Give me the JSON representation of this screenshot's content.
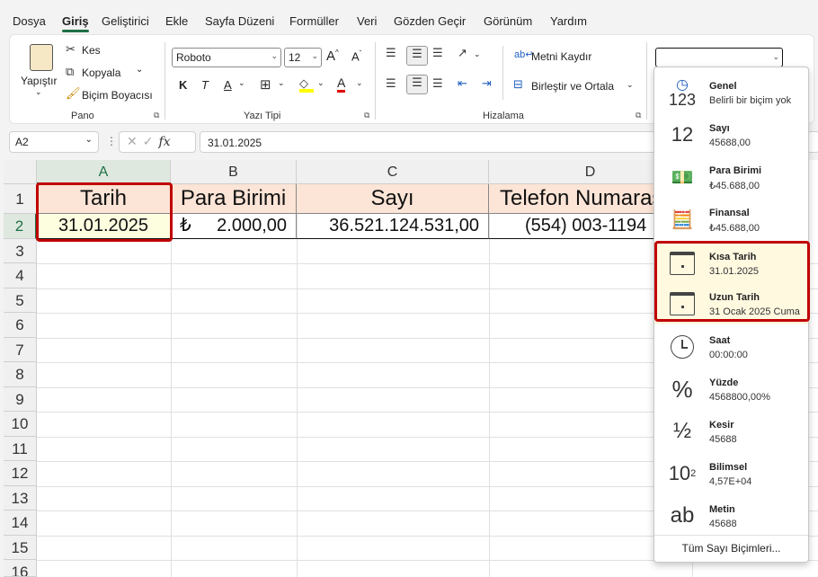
{
  "menu_tabs": [
    "Dosya",
    "Giriş",
    "Geliştirici",
    "Ekle",
    "Sayfa Düzeni",
    "Formüller",
    "Veri",
    "Gözden Geçir",
    "Görünüm",
    "Yardım"
  ],
  "ribbon": {
    "clipboard": {
      "paste": "Yapıştır",
      "cut": "Kes",
      "copy": "Kopyala",
      "format_painter": "Biçim Boyacısı",
      "label": "Pano"
    },
    "font": {
      "name": "Roboto",
      "size": "12",
      "grow": "A",
      "shrink": "A",
      "bold": "K",
      "italic": "T",
      "underline": "A",
      "font_color": "A",
      "label": "Yazı Tipi"
    },
    "alignment": {
      "wrap_text": "Metni Kaydır",
      "merge_center": "Birleştir ve Ortala",
      "label": "Hizalama"
    },
    "number_format": {
      "value": ""
    }
  },
  "formula_bar": {
    "name_box": "A2",
    "fx": "fx",
    "formula": "31.01.2025"
  },
  "columns": [
    "A",
    "B",
    "C",
    "D"
  ],
  "rows": [
    "1",
    "2",
    "3",
    "4",
    "5",
    "6",
    "7",
    "8",
    "9",
    "10",
    "11",
    "12",
    "13",
    "14",
    "15",
    "16"
  ],
  "headers": [
    "Tarih",
    "Para Birimi",
    "Sayı",
    "Telefon Numarası"
  ],
  "data_row": {
    "date": "31.01.2025",
    "currency_symbol": "₺",
    "currency_value": "2.000,00",
    "number": "36.521.124.531,00",
    "phone": "(554) 003-1194"
  },
  "format_menu": {
    "items": [
      {
        "name": "Genel",
        "example": "Belirli bir biçim yok",
        "icon": "clock-123-icon"
      },
      {
        "name": "Sayı",
        "example": "45688,00",
        "icon": "number-12-icon"
      },
      {
        "name": "Para Birimi",
        "example": "₺45.688,00",
        "icon": "currency-icon"
      },
      {
        "name": "Finansal",
        "example": "₺45.688,00",
        "icon": "accounting-icon"
      },
      {
        "name": "Kısa Tarih",
        "example": "31.01.2025",
        "icon": "calendar-icon"
      },
      {
        "name": "Uzun Tarih",
        "example": "31 Ocak 2025 Cuma",
        "icon": "calendar-icon"
      },
      {
        "name": "Saat",
        "example": "00:00:00",
        "icon": "clock-icon"
      },
      {
        "name": "Yüzde",
        "example": "4568800,00%",
        "icon": "percent-icon"
      },
      {
        "name": "Kesir",
        "example": "45688",
        "icon": "fraction-icon"
      },
      {
        "name": "Bilimsel",
        "example": "4,57E+04",
        "icon": "scientific-icon"
      },
      {
        "name": "Metin",
        "example": "45688",
        "icon": "text-ab-icon"
      }
    ],
    "footer": "Tüm Sayı Biçimleri..."
  },
  "colors": {
    "accent": "#1e7145",
    "highlight": "#c00000",
    "header_fill": "#fce4d6",
    "selected_fill": "#fdfde0"
  }
}
